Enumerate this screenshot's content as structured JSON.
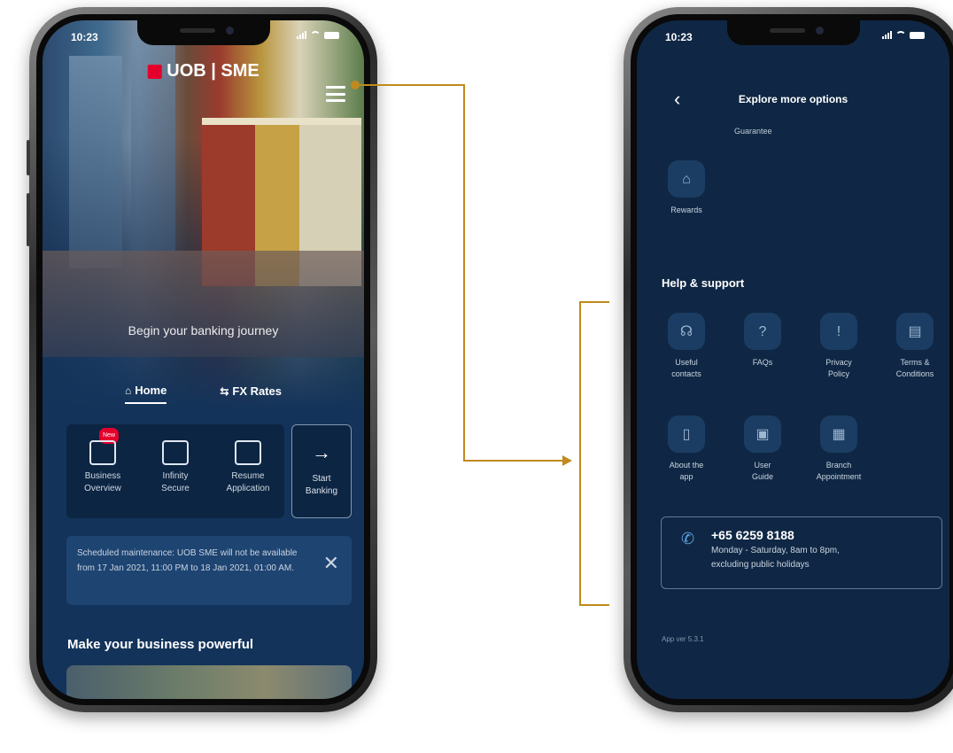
{
  "left_screen": {
    "status_time": "10:23",
    "brand": "UOB | SME",
    "tagline": "Begin your banking journey",
    "tabs": [
      {
        "label": "Home",
        "icon": "home-icon"
      },
      {
        "label": "FX Rates",
        "icon": "fx-icon"
      }
    ],
    "quick_actions": [
      {
        "label_1": "Business",
        "label_2": "Overview",
        "icon": "chart-icon",
        "badge": "New"
      },
      {
        "label_1": "Infinity",
        "label_2": "Secure",
        "icon": "secure-lock-icon"
      },
      {
        "label_1": "Resume",
        "label_2": "Application",
        "icon": "application-icon"
      }
    ],
    "start_banking": {
      "line_1": "Start",
      "line_2": "Banking",
      "arrow": "→"
    },
    "notice": "Scheduled maintenance: UOB SME will not be available from 17 Jan 2021, 11:00 PM to 18 Jan 2021, 01:00 AM.",
    "notice_close": "✕",
    "section_title": "Make your business powerful"
  },
  "right_screen": {
    "status_time": "10:23",
    "header_title": "Explore more options",
    "back": "‹",
    "guarantee_label": "Guarantee",
    "rewards_label": "Rewards",
    "help_title": "Help & support",
    "help_items": [
      {
        "line_1": "Useful",
        "line_2": "contacts",
        "icon": "headset-icon",
        "glyph": "☊"
      },
      {
        "line_1": "FAQs",
        "line_2": "",
        "icon": "faq-icon",
        "glyph": "?"
      },
      {
        "line_1": "Privacy",
        "line_2": "Policy",
        "icon": "shield-icon",
        "glyph": "!"
      },
      {
        "line_1": "Terms &",
        "line_2": "Conditions",
        "icon": "document-icon",
        "glyph": "▤"
      },
      {
        "line_1": "About the",
        "line_2": "app",
        "icon": "phone-device-icon",
        "glyph": "▯"
      },
      {
        "line_1": "User",
        "line_2": "Guide",
        "icon": "guide-icon",
        "glyph": "▣"
      },
      {
        "line_1": "Branch",
        "line_2": "Appointment",
        "icon": "calendar-icon",
        "glyph": "▦"
      }
    ],
    "contact": {
      "phone": "+65 6259 8188",
      "hours_1": "Monday - Saturday, 8am to 8pm,",
      "hours_2": "excluding public holidays"
    },
    "app_version": "App ver 5.3.1"
  },
  "colors": {
    "accent_connector": "#c08a1e",
    "screen_bg": "#0f2744",
    "uob_red": "#e4002b"
  }
}
